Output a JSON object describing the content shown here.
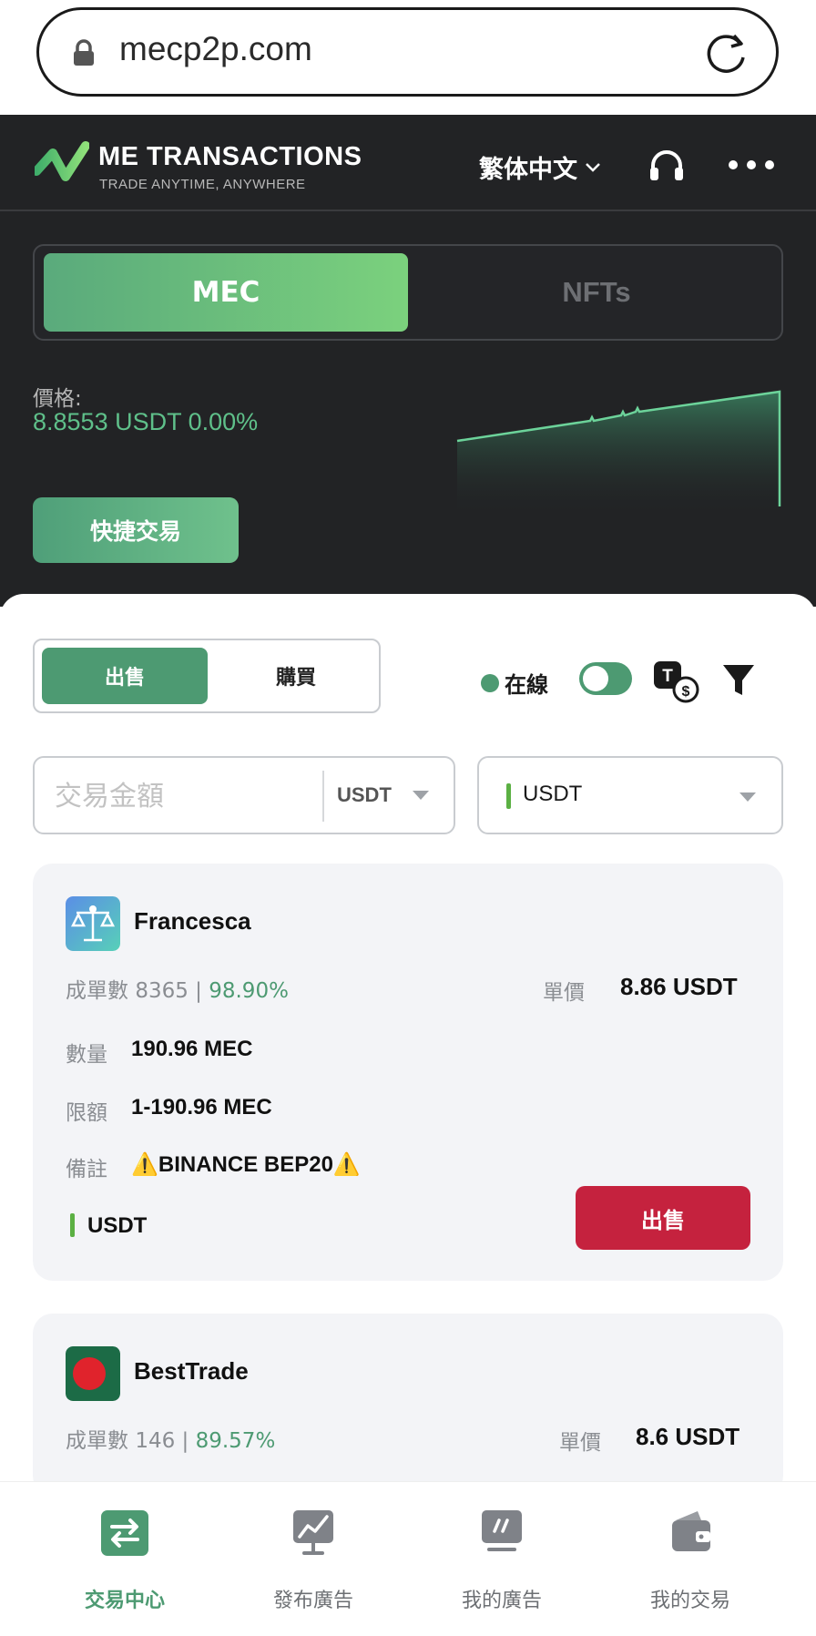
{
  "browser": {
    "url": "mecp2p.com"
  },
  "header": {
    "brand": "ME TRANSACTIONS",
    "tagline": "TRADE ANYTIME, ANYWHERE",
    "language": "繁体中文"
  },
  "market_tabs": {
    "mec": "MEC",
    "nfts": "NFTs"
  },
  "price": {
    "label": "價格:",
    "value": "8.8553 USDT 0.00%"
  },
  "quick_trade": "快捷交易",
  "trade_toggle": {
    "sell": "出售",
    "buy": "購買"
  },
  "filters": {
    "online_label": "在線",
    "online_enabled": true,
    "amount_placeholder": "交易金額",
    "amount_unit": "USDT",
    "coin": "USDT"
  },
  "listings": [
    {
      "name": "Francesca",
      "orders_label": "成單數",
      "orders": "8365",
      "rate": "98.90%",
      "unit_price_label": "單價",
      "unit_price": "8.86 USDT",
      "quantity_label": "數量",
      "quantity": "190.96 MEC",
      "limit_label": "限額",
      "limit": "1-190.96 MEC",
      "note_label": "備註",
      "note": "⚠️BINANCE BEP20⚠️",
      "coin": "USDT",
      "action": "出售"
    },
    {
      "name": "BestTrade",
      "orders_label": "成單數",
      "orders": "146",
      "rate": "89.57%",
      "unit_price_label": "單價",
      "unit_price": "8.6 USDT"
    }
  ],
  "bottom_nav": [
    {
      "label": "交易中心",
      "icon": "swap-icon",
      "active": true
    },
    {
      "label": "發布廣告",
      "icon": "chart-board-icon",
      "active": false
    },
    {
      "label": "我的廣告",
      "icon": "ad-board-icon",
      "active": false
    },
    {
      "label": "我的交易",
      "icon": "wallet-icon",
      "active": false
    }
  ],
  "colors": {
    "accent": "#4d9a72",
    "accent_light": "#7bd17d",
    "sell_button": "#c5223e",
    "header_bg": "#222325",
    "price_text": "#5fc08a"
  }
}
